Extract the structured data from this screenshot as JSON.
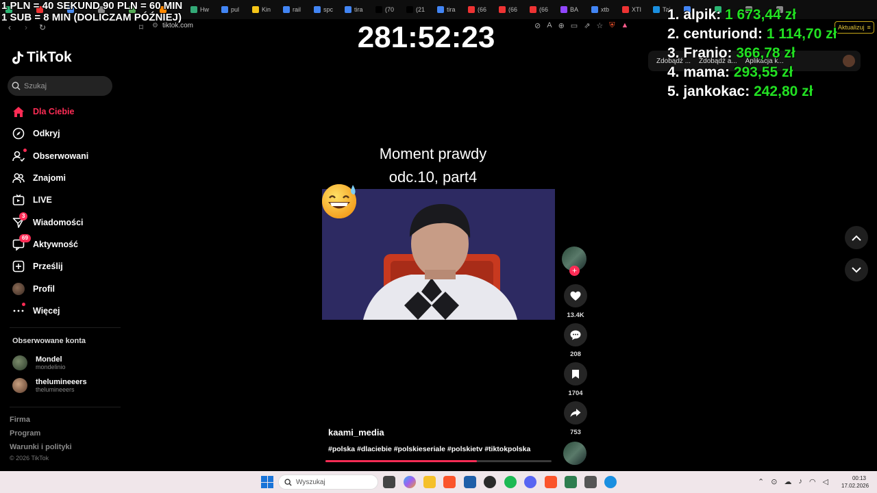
{
  "browser": {
    "tabs": [
      "",
      "",
      "",
      "",
      "",
      "",
      "Hw",
      "pul",
      "Kin",
      "rail",
      "spc",
      "tira",
      "(70",
      "(21",
      "tira",
      "(66",
      "(66",
      "(66",
      "BA",
      "xtb",
      "XTI",
      "Tai",
      "",
      "",
      "",
      ""
    ],
    "url": "tiktok.com",
    "update_label": "Aktualizuj",
    "bookmarks": [
      "Zdobądź ...",
      "Zdobądź a...",
      "Aplikacja k..."
    ]
  },
  "stream_overlay": {
    "rule_line1": "1 PLN = 40 SEKUND 90 PLN = 60 MIN",
    "rule_line2": "1 SUB = 8 MIN (DOLICZAM PÓŹNIEJ)",
    "timer": "281:52:23",
    "leaderboard": [
      {
        "name": "1. alpik:",
        "amount": "1 673,44 zł"
      },
      {
        "name": "2. centuriond:",
        "amount": "1 114,70 zł"
      },
      {
        "name": "3. Franio:",
        "amount": "366,78 zł"
      },
      {
        "name": "4. mama:",
        "amount": "293,55 zł"
      },
      {
        "name": "5. jankokac:",
        "amount": "242,80 zł"
      }
    ]
  },
  "sidebar": {
    "logo": "TikTok",
    "search_placeholder": "Szukaj",
    "items": [
      {
        "label": "Dla Ciebie",
        "icon": "home-icon"
      },
      {
        "label": "Odkryj",
        "icon": "compass-icon"
      },
      {
        "label": "Obserwowani",
        "icon": "following-icon"
      },
      {
        "label": "Znajomi",
        "icon": "friends-icon"
      },
      {
        "label": "LIVE",
        "icon": "live-icon"
      },
      {
        "label": "Wiadomości",
        "icon": "messages-icon",
        "badge": "3"
      },
      {
        "label": "Aktywność",
        "icon": "activity-icon",
        "badge": "69"
      },
      {
        "label": "Prześlij",
        "icon": "upload-icon"
      },
      {
        "label": "Profil",
        "icon": "profile-avatar"
      },
      {
        "label": "Więcej",
        "icon": "more-icon"
      }
    ],
    "followed_title": "Obserwowane konta",
    "followed": [
      {
        "name": "Mondel",
        "handle": "mondelinio"
      },
      {
        "name": "thelumineeers",
        "handle": "thelumineeers"
      }
    ],
    "footer": [
      "Firma",
      "Program",
      "Warunki i polityki"
    ],
    "copyright": "© 2026 TikTok"
  },
  "video": {
    "title_line1": "Moment prawdy",
    "title_line2": "odc.10, part4",
    "author": "kaami_media",
    "tags": "#polska #dlaciebie #polskieseriale #polskietv #tiktokpolska",
    "progress": 0.67,
    "likes": "13.4K",
    "comments": "208",
    "saves": "1704",
    "shares": "753"
  },
  "taskbar": {
    "search_placeholder": "Wyszukaj",
    "time": "00:13",
    "date": "17.02.2026"
  },
  "colors": {
    "accent": "#fe2c55",
    "money": "#22e022",
    "background": "#000000"
  }
}
